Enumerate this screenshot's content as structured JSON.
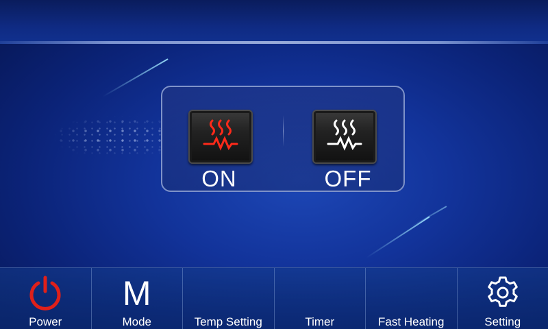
{
  "heater": {
    "on_label": "ON",
    "off_label": "OFF",
    "on_icon": "heater-icon",
    "off_icon": "heater-icon",
    "on_color": "#ff2a1a",
    "off_color": "#ffffff"
  },
  "toolbar": {
    "items": [
      {
        "label": "Power",
        "icon": "power-icon",
        "color": "#e0201a"
      },
      {
        "label": "Mode",
        "icon": "mode-icon",
        "glyph": "M"
      },
      {
        "label": "Temp Setting"
      },
      {
        "label": "Timer"
      },
      {
        "label": "Fast Heating"
      },
      {
        "label": "Setting",
        "icon": "gear-icon"
      }
    ]
  }
}
